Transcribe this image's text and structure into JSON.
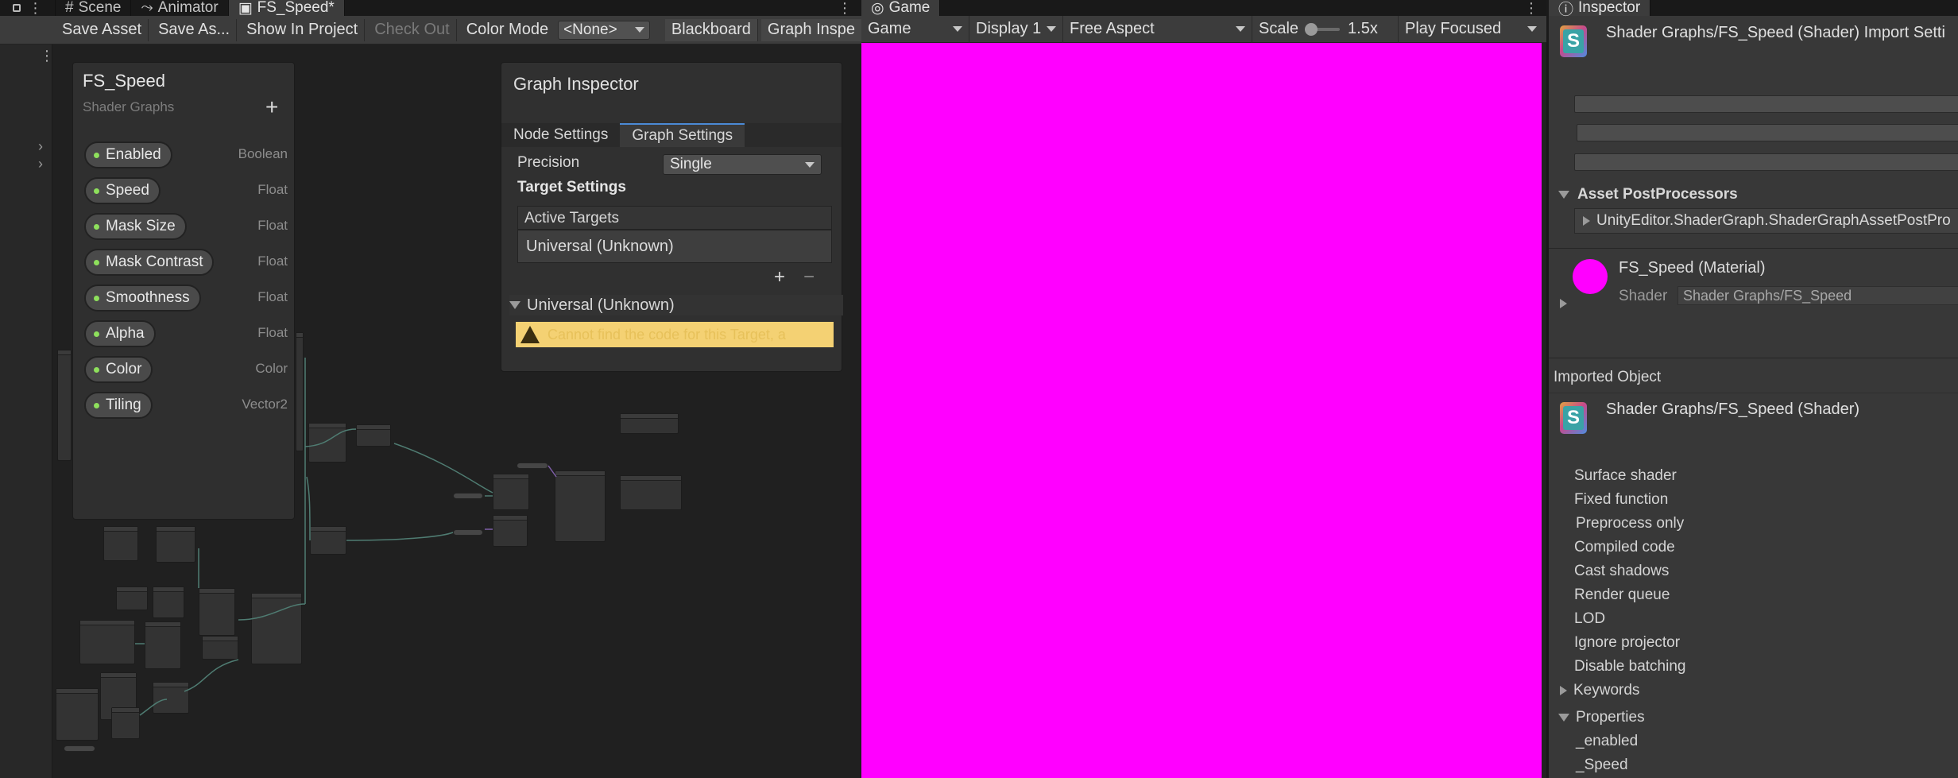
{
  "shader_graph": {
    "tabs": [
      {
        "label": "Scene"
      },
      {
        "label": "Animator"
      },
      {
        "label": "FS_Speed*"
      }
    ],
    "toolbar": {
      "save_asset": "Save Asset",
      "save_as": "Save As...",
      "show_in_project": "Show In Project",
      "check_out": "Check Out",
      "color_mode_label": "Color Mode",
      "color_mode_value": "<None>",
      "blackboard": "Blackboard",
      "graph_inspector": "Graph Inspe"
    },
    "blackboard": {
      "title": "FS_Speed",
      "subtitle": "Shader Graphs",
      "add": "+",
      "properties": [
        {
          "name": "Enabled",
          "type": "Boolean"
        },
        {
          "name": "Speed",
          "type": "Float"
        },
        {
          "name": "Mask Size",
          "type": "Float"
        },
        {
          "name": "Mask Contrast",
          "type": "Float"
        },
        {
          "name": "Smoothness",
          "type": "Float"
        },
        {
          "name": "Alpha",
          "type": "Float"
        },
        {
          "name": "Color",
          "type": "Color"
        },
        {
          "name": "Tiling",
          "type": "Vector2"
        }
      ]
    },
    "graph_inspector": {
      "title": "Graph Inspector",
      "tabs": [
        "Node Settings",
        "Graph Settings"
      ],
      "precision_label": "Precision",
      "precision_value": "Single",
      "target_settings": "Target Settings",
      "active_targets": "Active Targets",
      "target_item": "Universal (Unknown)",
      "plus": "+",
      "minus": "−",
      "foldout": "Universal (Unknown)",
      "warning_text": "Cannot find the code for this Target, a"
    }
  },
  "game": {
    "tab": "Game",
    "display_mode": "Game",
    "display": "Display 1",
    "aspect": "Free Aspect",
    "scale_label": "Scale",
    "scale_value": "1.5x",
    "play_mode": "Play Focused",
    "background_color": "#ff00ff"
  },
  "inspector": {
    "tab": "Inspector",
    "header_title": "Shader Graphs/FS_Speed (Shader) Import Setti",
    "asset_postprocessors": "Asset PostProcessors",
    "postprocessor_item": "UnityEditor.ShaderGraph.ShaderGraphAssetPostPro",
    "material_name": "FS_Speed (Material)",
    "shader_label": "Shader",
    "shader_value": "Shader Graphs/FS_Speed",
    "imported_object": "Imported Object",
    "imported_title": "Shader Graphs/FS_Speed (Shader)",
    "info_items": [
      "Surface shader",
      "Fixed function",
      "Preprocess only",
      "Compiled code",
      "Cast shadows",
      "Render queue",
      "LOD",
      "Ignore projector",
      "Disable batching"
    ],
    "keywords": "Keywords",
    "properties_label": "Properties",
    "property_items": [
      "_enabled",
      "_Speed"
    ],
    "material_color": "#ff00ff"
  }
}
